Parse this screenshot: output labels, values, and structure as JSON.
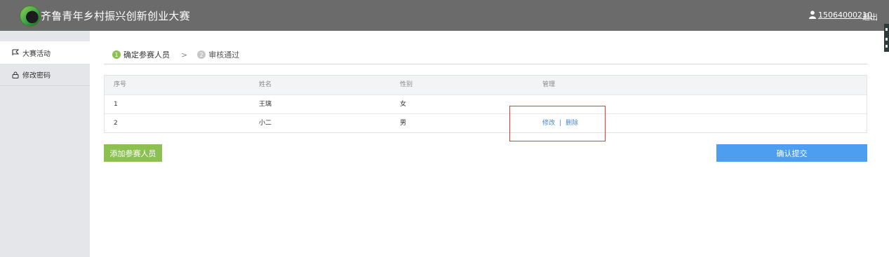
{
  "header": {
    "title": "齐鲁青年乡村振兴创新创业大赛",
    "user": "15064000210",
    "logout": "退出",
    "logo_icon": "leaf-logo-icon",
    "user_icon": "user-icon"
  },
  "sidebar": {
    "items": [
      {
        "label": "大赛活动",
        "icon": "flag-icon",
        "active": true
      },
      {
        "label": "修改密码",
        "icon": "lock-icon",
        "active": false
      }
    ]
  },
  "steps": {
    "items": [
      {
        "num": "1",
        "label": "确定参赛人员",
        "state": "done"
      },
      {
        "num": "2",
        "label": "审核通过",
        "state": "todo"
      }
    ],
    "separator": ">"
  },
  "table": {
    "headers": [
      "序号",
      "姓名",
      "性别",
      "管理"
    ],
    "rows": [
      {
        "index": "1",
        "name": "王璃",
        "gender": "女"
      },
      {
        "index": "2",
        "name": "小二",
        "gender": "男",
        "edit": "修改",
        "divider": "|",
        "delete": "删除"
      }
    ]
  },
  "buttons": {
    "add": "添加参赛人员",
    "submit": "确认提交"
  },
  "colors": {
    "header_bg": "#6b6b6b",
    "green": "#8cc152",
    "blue": "#4d9ef0",
    "highlight": "#e23b3b",
    "link": "#4a86c8"
  }
}
